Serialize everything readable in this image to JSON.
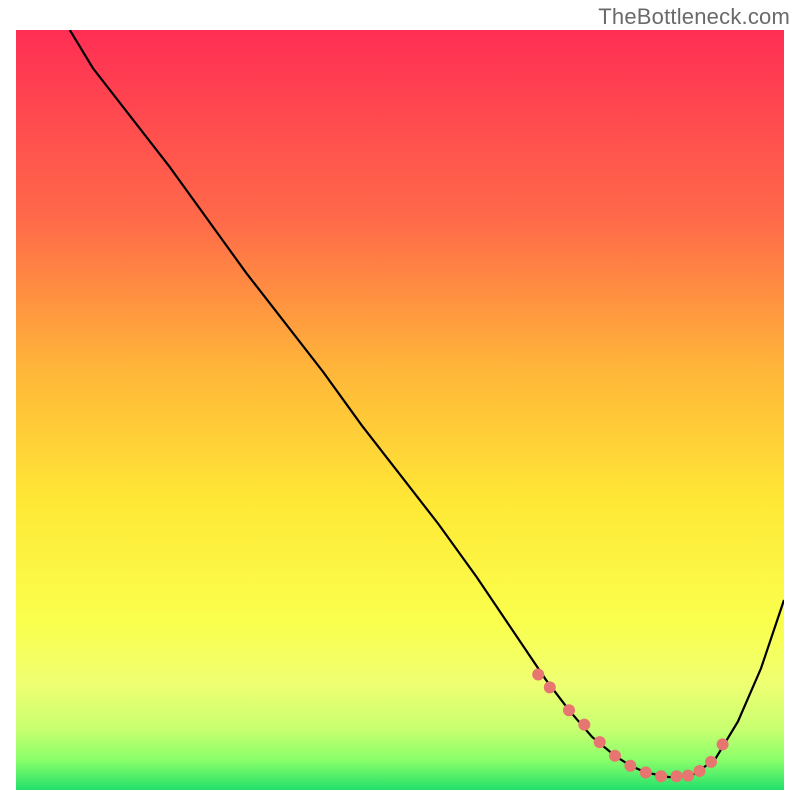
{
  "watermark": "TheBottleneck.com",
  "chart_data": {
    "type": "line",
    "title": "",
    "xlabel": "",
    "ylabel": "",
    "xlim": [
      0,
      100
    ],
    "ylim": [
      0,
      100
    ],
    "grid": false,
    "legend": false,
    "series": [
      {
        "name": "curve",
        "x": [
          7,
          10,
          15,
          20,
          25,
          30,
          35,
          40,
          45,
          50,
          55,
          60,
          63,
          66,
          69,
          72,
          75,
          78,
          80,
          82,
          85,
          88,
          91,
          94,
          97,
          100
        ],
        "y": [
          100,
          95,
          88.5,
          82,
          75,
          68,
          61.5,
          55,
          48,
          41.5,
          35,
          28,
          23.5,
          19,
          14.5,
          10.5,
          7,
          4.5,
          3.2,
          2.3,
          1.7,
          1.9,
          4,
          9,
          16,
          25
        ]
      }
    ],
    "highlight_points": {
      "name": "dots",
      "x": [
        68,
        69.5,
        72,
        74,
        76,
        78,
        80,
        82,
        84,
        86,
        87.5,
        89,
        90.5,
        92
      ],
      "y": [
        15.2,
        13.5,
        10.5,
        8.6,
        6.3,
        4.5,
        3.2,
        2.3,
        1.8,
        1.8,
        1.9,
        2.5,
        3.7,
        6.0
      ]
    },
    "gradient_stops": [
      {
        "offset": 0,
        "color": "#ff2e54"
      },
      {
        "offset": 25,
        "color": "#ff6a49"
      },
      {
        "offset": 45,
        "color": "#ffb739"
      },
      {
        "offset": 62,
        "color": "#ffe836"
      },
      {
        "offset": 78,
        "color": "#faff4d"
      },
      {
        "offset": 86,
        "color": "#efff72"
      },
      {
        "offset": 92,
        "color": "#c8ff70"
      },
      {
        "offset": 96,
        "color": "#8bff6a"
      },
      {
        "offset": 100,
        "color": "#23e06a"
      }
    ]
  }
}
